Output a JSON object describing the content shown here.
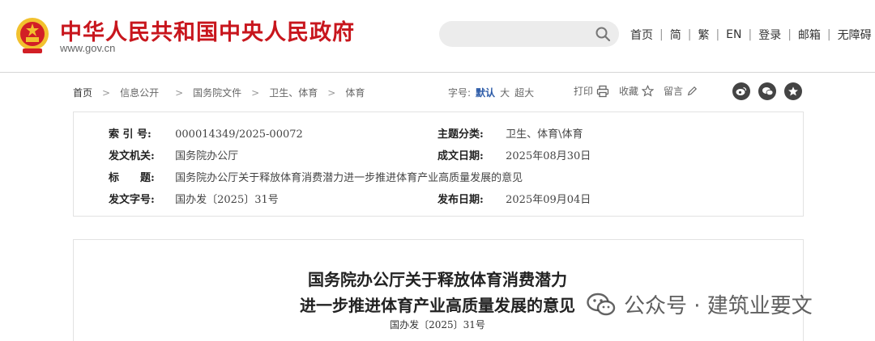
{
  "header": {
    "site_name": "中华人民共和国中央人民政府",
    "site_domain": "www.gov.cn",
    "search": {
      "placeholder": ""
    },
    "links": [
      "首页",
      "简",
      "繁",
      "EN",
      "登录",
      "邮箱",
      "无障碍"
    ]
  },
  "breadcrumb": [
    "首页",
    "信息公开",
    "国务院文件",
    "卫生、体育",
    "体育"
  ],
  "fontsize": {
    "label": "字号:",
    "options": [
      "默认",
      "大",
      "超大"
    ],
    "selected": "默认"
  },
  "tools": {
    "print": "打印",
    "favorite": "收藏",
    "comment": "留言"
  },
  "share_icons": [
    "weibo-icon",
    "wechat-icon",
    "star-icon"
  ],
  "info": {
    "index_label": "索 引 号:",
    "index_value": "000014349/2025-00072",
    "category_label": "主题分类:",
    "category_value": "卫生、体育\\体育",
    "issuer_label": "发文机关:",
    "issuer_value": "国务院办公厅",
    "date_label": "成文日期:",
    "date_value": "2025年08月30日",
    "title_label": "标　　题:",
    "title_value": "国务院办公厅关于释放体育消费潜力进一步推进体育产业高质量发展的意见",
    "docno_label": "发文字号:",
    "docno_value": "国办发〔2025〕31号",
    "pubdate_label": "发布日期:",
    "pubdate_value": "2025年09月04日"
  },
  "document": {
    "title_line1": "国务院办公厅关于释放体育消费潜力",
    "title_line2": "进一步推进体育产业高质量发展的意见",
    "number": "国办发〔2025〕31号"
  },
  "watermark": {
    "text": "公众号 · 建筑业要文"
  },
  "colors": {
    "brand_red": "#c8161d",
    "active_blue": "#2b5aa7",
    "emblem_gold": "#f2c12e"
  }
}
